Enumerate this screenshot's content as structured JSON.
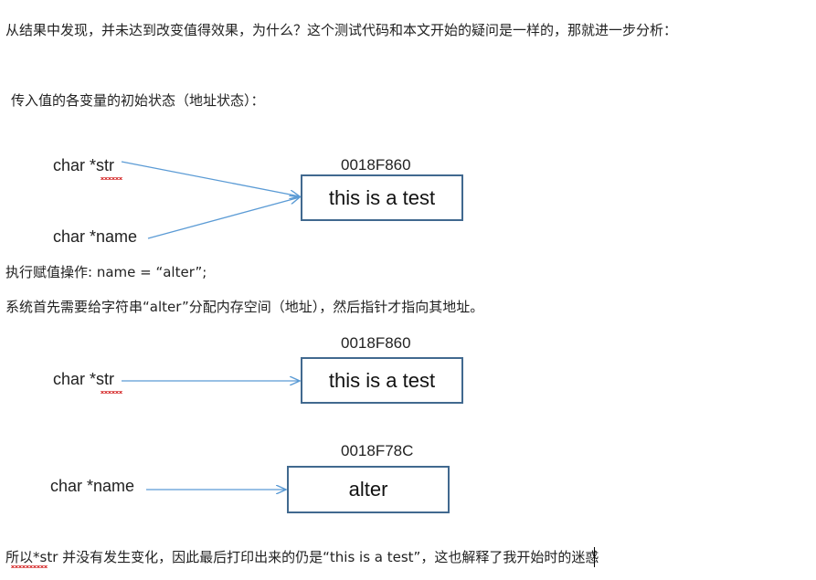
{
  "paragraphs": {
    "intro": "从结果中发现，并未达到改变值得效果，为什么？这个测试代码和本文开始的疑问是一样的，那就进一步分析：",
    "initial_state": "传入值的各变量的初始状态（地址状态）：",
    "assign_op": "执行赋值操作: name = “alter”;",
    "system_alloc": "系统首先需要给字符串“alter”分配内存空间（地址），然后指针才指向其地址。",
    "conclusion": "所以*str 并没有发生变化，因此最后打印出来的仍是“this is a test”，这也解释了我开始时的迷惑"
  },
  "diagram1": {
    "var_str": "char *str",
    "var_name": "char *name",
    "address": "0018F860",
    "box_text": "this is a test"
  },
  "diagram2": {
    "var_str": "char *str",
    "address": "0018F860",
    "box_text": "this is a test"
  },
  "diagram3": {
    "var_name": "char *name",
    "address": "0018F78C",
    "box_text": "alter"
  },
  "colors": {
    "arrow": "#5b9bd5",
    "box_border": "#41698f",
    "spellcheck": "#d93a3a"
  }
}
